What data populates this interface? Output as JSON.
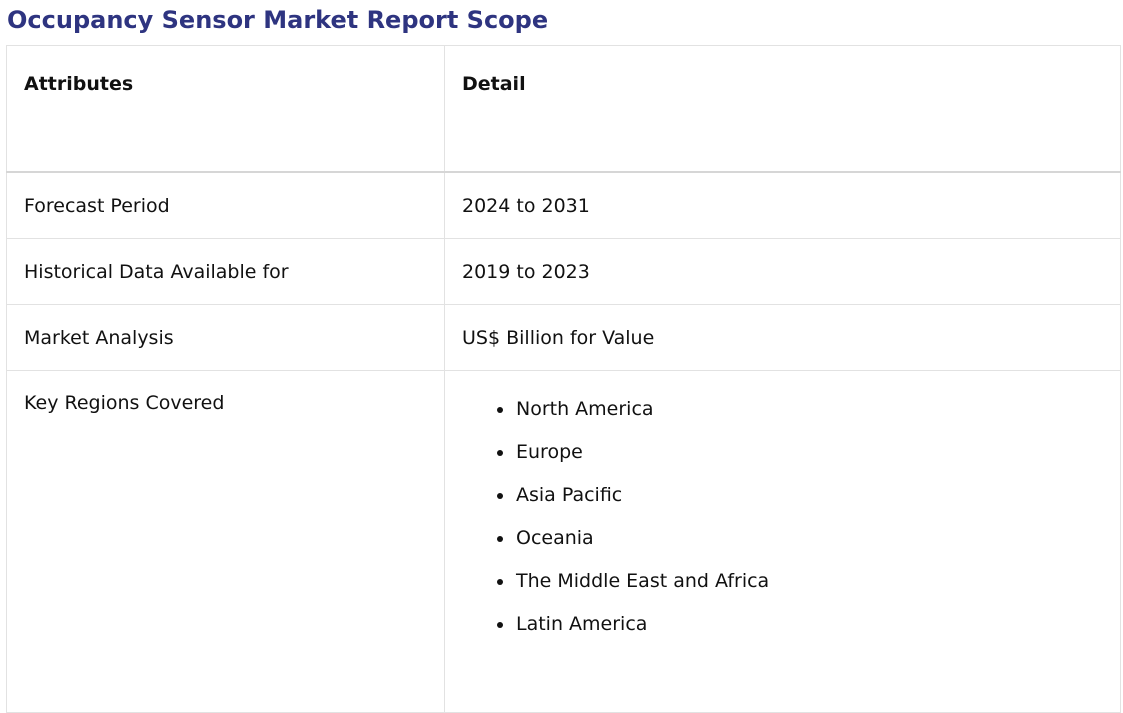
{
  "title": "Occupancy Sensor Market Report Scope",
  "table": {
    "headers": [
      "Attributes",
      "Detail"
    ],
    "rows": [
      {
        "attribute": "Forecast Period",
        "detail": "2024 to 2031"
      },
      {
        "attribute": "Historical Data Available for",
        "detail": "2019 to 2023"
      },
      {
        "attribute": "Market Analysis",
        "detail": "US$ Billion for Value"
      }
    ],
    "regions_row": {
      "attribute": "Key Regions Covered",
      "regions": [
        "North America",
        "Europe",
        "Asia Pacific",
        "Oceania",
        "The Middle East and Africa",
        "Latin America"
      ]
    }
  }
}
